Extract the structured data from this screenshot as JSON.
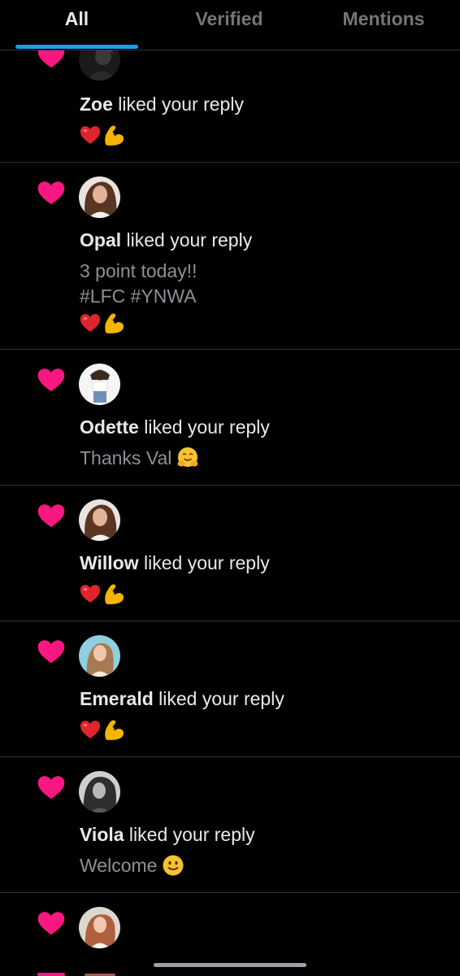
{
  "colors": {
    "background": "#000000",
    "accent": "#1d9bf0",
    "like_pink": "#f91880",
    "divider": "#2f3336",
    "muted_text": "#71767b"
  },
  "tabs": [
    {
      "label": "All",
      "active": true
    },
    {
      "label": "Verified",
      "active": false
    },
    {
      "label": "Mentions",
      "active": false
    }
  ],
  "notifications": [
    {
      "icon": "heart-icon",
      "name": "Zoe",
      "action": " liked your reply",
      "body": "",
      "emoji": [
        "red-heart-emoji",
        "flexed-biceps-emoji"
      ]
    },
    {
      "icon": "heart-icon",
      "name": "Opal",
      "action": " liked your reply",
      "body_lines": [
        "3 point today!!",
        "#LFC #YNWA"
      ],
      "emoji": [
        "red-heart-emoji",
        "flexed-biceps-emoji"
      ]
    },
    {
      "icon": "heart-icon",
      "name": "Odette",
      "action": " liked your reply",
      "body": "Thanks Val",
      "emoji": [
        "hugging-face-emoji"
      ]
    },
    {
      "icon": "heart-icon",
      "name": "Willow",
      "action": " liked your reply",
      "body": "",
      "emoji": [
        "red-heart-emoji",
        "flexed-biceps-emoji"
      ]
    },
    {
      "icon": "heart-icon",
      "name": "Emerald",
      "action": " liked your reply",
      "body": "",
      "emoji": [
        "red-heart-emoji",
        "flexed-biceps-emoji"
      ]
    },
    {
      "icon": "heart-icon",
      "name": "Viola",
      "action": " liked your reply",
      "body": "Welcome",
      "emoji": [
        "slightly-smiling-face-emoji"
      ]
    },
    {
      "icon": "heart-icon",
      "name": "",
      "action": "",
      "body": "",
      "emoji": []
    }
  ]
}
